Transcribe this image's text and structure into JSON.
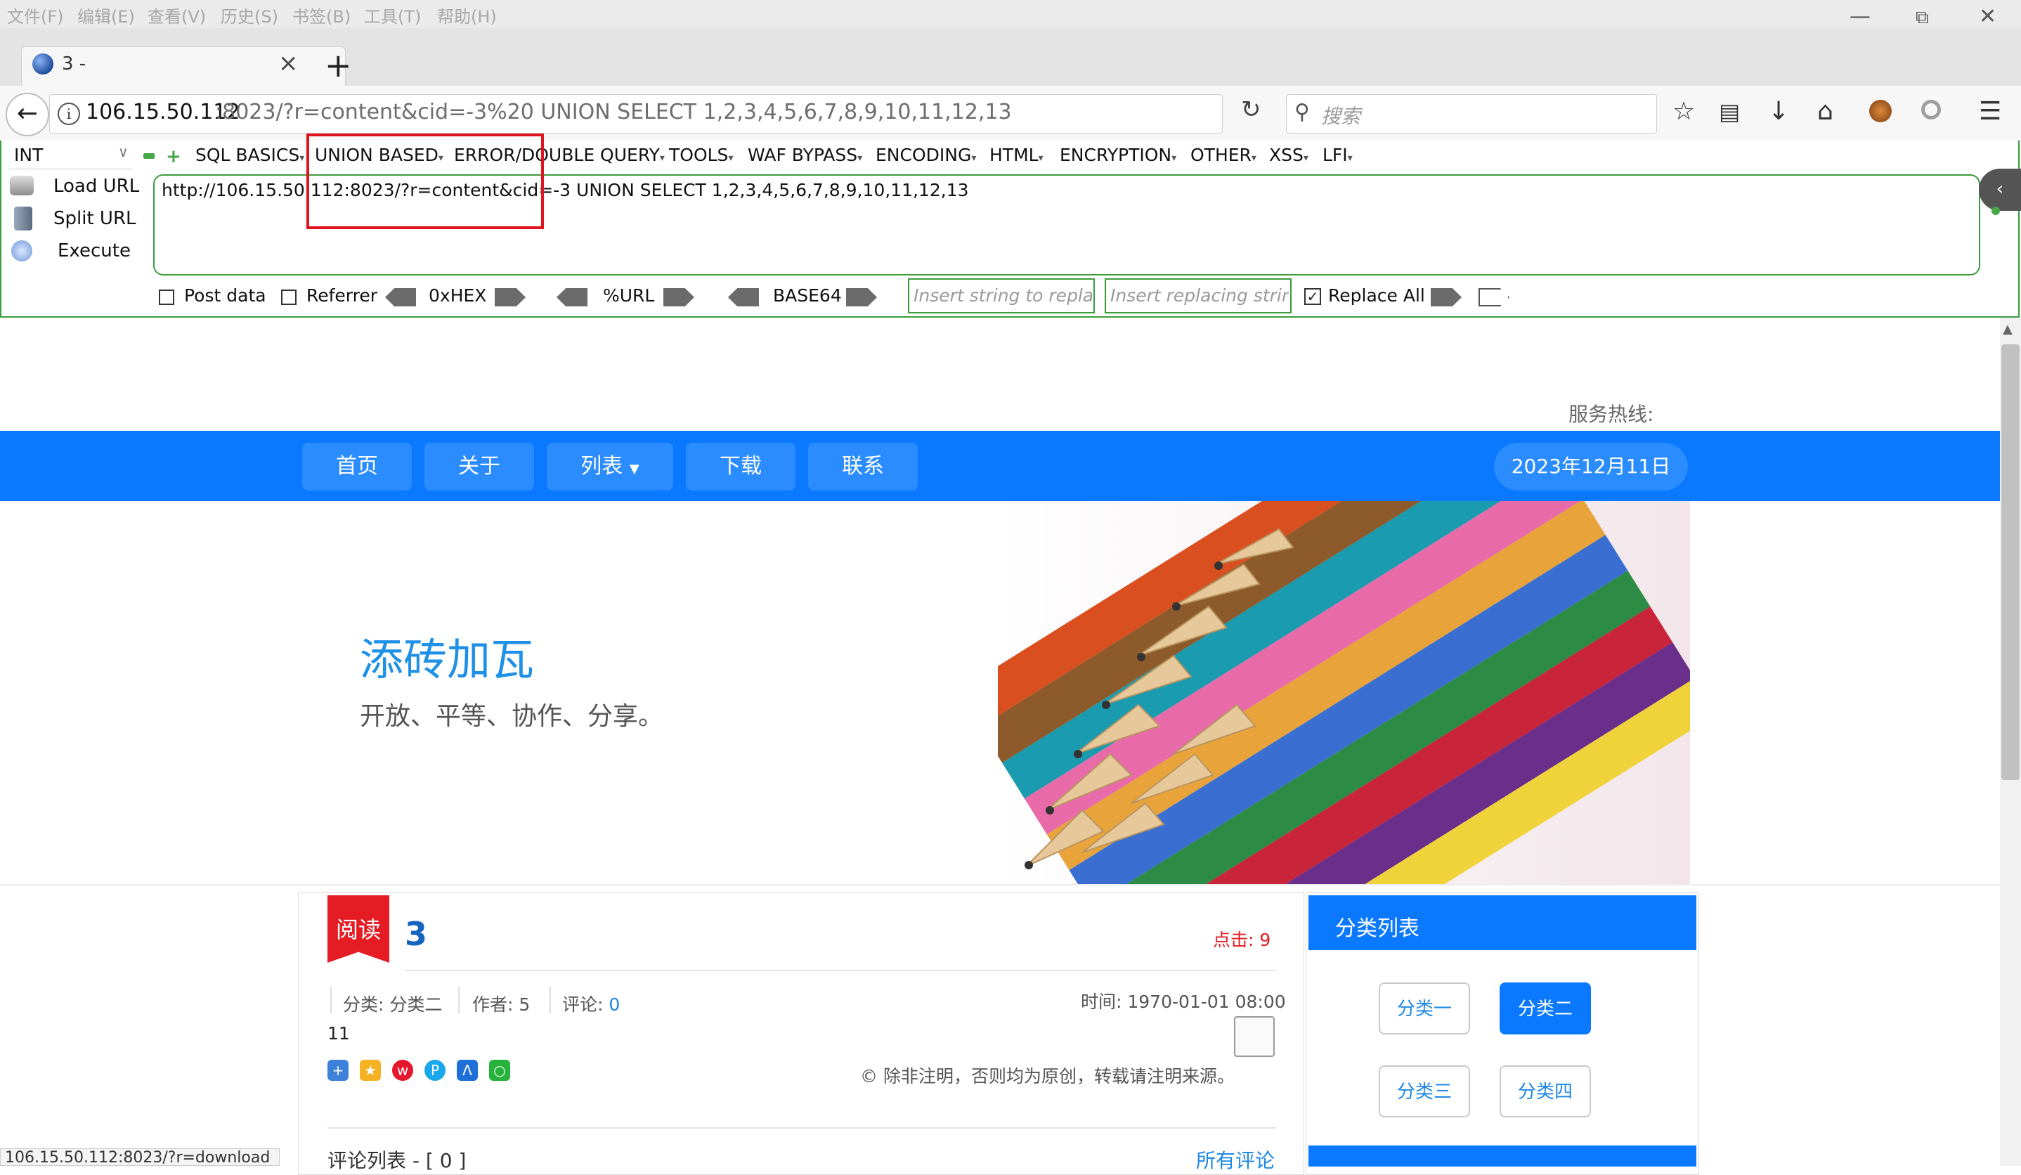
{
  "menubar": {
    "items": [
      "文件(F)",
      "编辑(E)",
      "查看(V)",
      "历史(S)",
      "书签(B)",
      "工具(T)",
      "帮助(H)"
    ]
  },
  "tab": {
    "title": "3 -"
  },
  "address_bar": {
    "host": "106.15.50.112",
    "rest": ":8023/?r=content&cid=-3%20 UNION SELECT 1,2,3,4,5,6,7,8,9,10,11,12,13"
  },
  "search": {
    "placeholder": "搜索"
  },
  "hackbar": {
    "select_value": "INT",
    "menus": [
      "SQL BASICS",
      "UNION BASED",
      "ERROR/DOUBLE QUERY",
      "TOOLS",
      "WAF BYPASS",
      "ENCODING",
      "HTML",
      "ENCRYPTION",
      "OTHER",
      "XSS",
      "LFI"
    ],
    "load_url": "Load URL",
    "split_url": "Split URL",
    "execute": "Execute",
    "url_text": "http://106.15.50.112:8023/?r=content&cid=-3 UNION SELECT 1,2,3,4,5,6,7,8,9,10,11,12,13",
    "post_data": "Post data",
    "referrer": "Referrer",
    "hex": "0xHEX",
    "urlenc": "%URL",
    "base64": "BASE64",
    "insert_find_ph": "Insert string to replace",
    "insert_replace_ph": "Insert replacing string",
    "replace_all": "Replace All"
  },
  "site": {
    "hotline": "服务热线:",
    "nav": [
      "首页",
      "关于",
      "列表",
      "下载",
      "联系"
    ],
    "date": "2023年12月11日",
    "hero_title": "添砖加瓦",
    "hero_sub": "开放、平等、协作、分享。"
  },
  "article": {
    "badge": "阅读",
    "title": "3",
    "clicks": "点击: 9",
    "category": "分类: 分类二",
    "author": "作者: 5",
    "comments_label": "评论:",
    "comments_count": "0",
    "time": "时间: 1970-01-01 08:00",
    "body": "11",
    "copyright": "© 除非注明，否则均为原创，转载请注明来源。",
    "comment_list": "评论列表 - [ 0 ]",
    "all_comments": "所有评论"
  },
  "categories": {
    "title": "分类列表",
    "items": [
      "分类一",
      "分类二",
      "分类三",
      "分类四"
    ],
    "active_index": 1
  },
  "status_bar": "106.15.50.112:8023/?r=download",
  "colors": {
    "accent_blue": "#0a78ff",
    "hackbar_green": "#3c9c3c",
    "annotation_red": "#e0141e"
  }
}
